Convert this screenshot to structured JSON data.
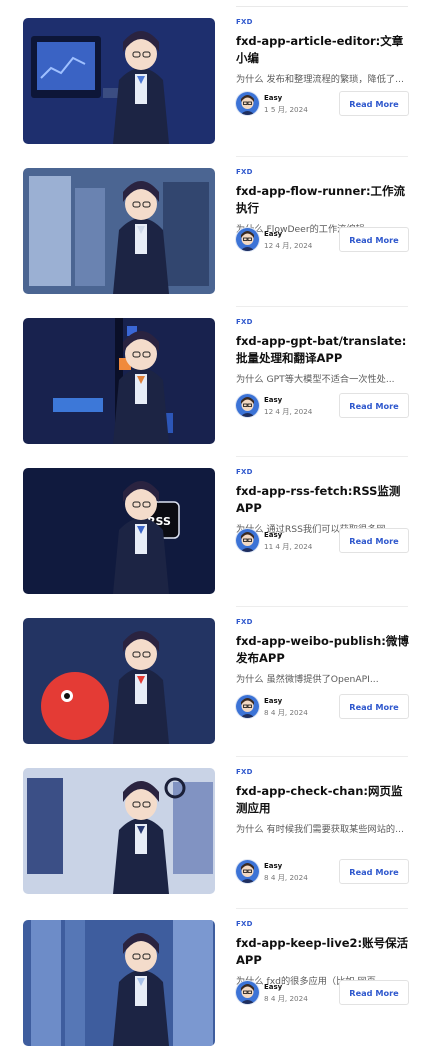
{
  "articles": [
    {
      "category": "FXD",
      "title": "fxd-app-article-editor:文章小编",
      "excerpt": "为什么 发布和整理流程的繁琐，降低了...",
      "author": "Easy",
      "date": "1 5 月, 2024",
      "read_more": "Read More",
      "colors": {
        "bg": "#1e2f6e",
        "accent": "#4e7ad6"
      }
    },
    {
      "category": "FXD",
      "title": "fxd-app-flow-runner:工作流执行",
      "excerpt": "为什么 FlowDeer的工作流编辑...",
      "author": "Easy",
      "date": "12 4 月, 2024",
      "read_more": "Read More",
      "colors": {
        "bg": "#4b6592",
        "accent": "#cfd9ea"
      }
    },
    {
      "category": "FXD",
      "title": "fxd-app-gpt-bat/translate:批量处理和翻译APP",
      "excerpt": "为什么 GPT等大模型不适合一次性处...",
      "author": "Easy",
      "date": "12 4 月, 2024",
      "read_more": "Read More",
      "colors": {
        "bg": "#18224e",
        "accent": "#e0823c"
      }
    },
    {
      "category": "FXD",
      "title": "fxd-app-rss-fetch:RSS监测APP",
      "excerpt": "为什么 通过RSS我们可以获取很多网...",
      "author": "Easy",
      "date": "11 4 月, 2024",
      "read_more": "Read More",
      "badge": "RSS",
      "colors": {
        "bg": "#101a3e",
        "accent": "#3c66c9"
      }
    },
    {
      "category": "FXD",
      "title": "fxd-app-weibo-publish:微博发布APP",
      "excerpt": "为什么 虽然微博提供了OpenAPI...",
      "author": "Easy",
      "date": "8 4 月, 2024",
      "read_more": "Read More",
      "colors": {
        "bg": "#233463",
        "accent": "#e43b35"
      }
    },
    {
      "category": "FXD",
      "title": "fxd-app-check-chan:网页监测应用",
      "excerpt": "为什么 有时候我们需要获取某些网站的...",
      "author": "Easy",
      "date": "8 4 月, 2024",
      "read_more": "Read More",
      "colors": {
        "bg": "#c9d3e6",
        "accent": "#283a73"
      }
    },
    {
      "category": "FXD",
      "title": "fxd-app-keep-live2:账号保活APP",
      "excerpt": "为什么 fxd的很多应用（比如 网页...",
      "author": "Easy",
      "date": "8 4 月, 2024",
      "read_more": "Read More",
      "colors": {
        "bg": "#3e5d9e",
        "accent": "#a9c2ea"
      }
    }
  ]
}
